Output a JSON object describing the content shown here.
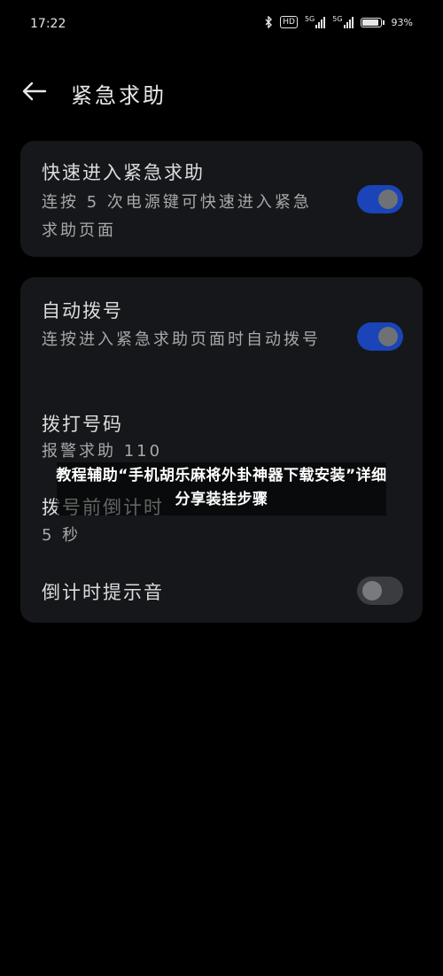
{
  "status": {
    "time": "17:22",
    "hd": "HD",
    "sim1": "5G",
    "sim2": "5G",
    "battery": "93%",
    "battery_level": 0.93
  },
  "header": {
    "title": "紧急求助",
    "back_icon": "arrow-left-icon"
  },
  "quick_entry": {
    "title": "快速进入紧急求助",
    "subtitle": "连按 5 次电源键可快速进入紧急求助页面",
    "enabled": true
  },
  "auto_dial": {
    "title": "自动拨号",
    "subtitle": "连按进入紧急求助页面时自动拨号",
    "enabled": true
  },
  "dial_number": {
    "title": "拨打号码",
    "value": "报警求助 110"
  },
  "dial_countdown": {
    "title": "拨号前倒计时",
    "value": "5 秒"
  },
  "countdown_sound": {
    "title": "倒计时提示音",
    "enabled": false
  },
  "overlay": {
    "text": "教程辅助“手机胡乐麻将外卦神器下载安装”详细分享装挂步骤"
  },
  "colors": {
    "background": "#000000",
    "card": "#15171a",
    "toggle_on": "#1a44b8",
    "toggle_off": "#3a3c40"
  }
}
